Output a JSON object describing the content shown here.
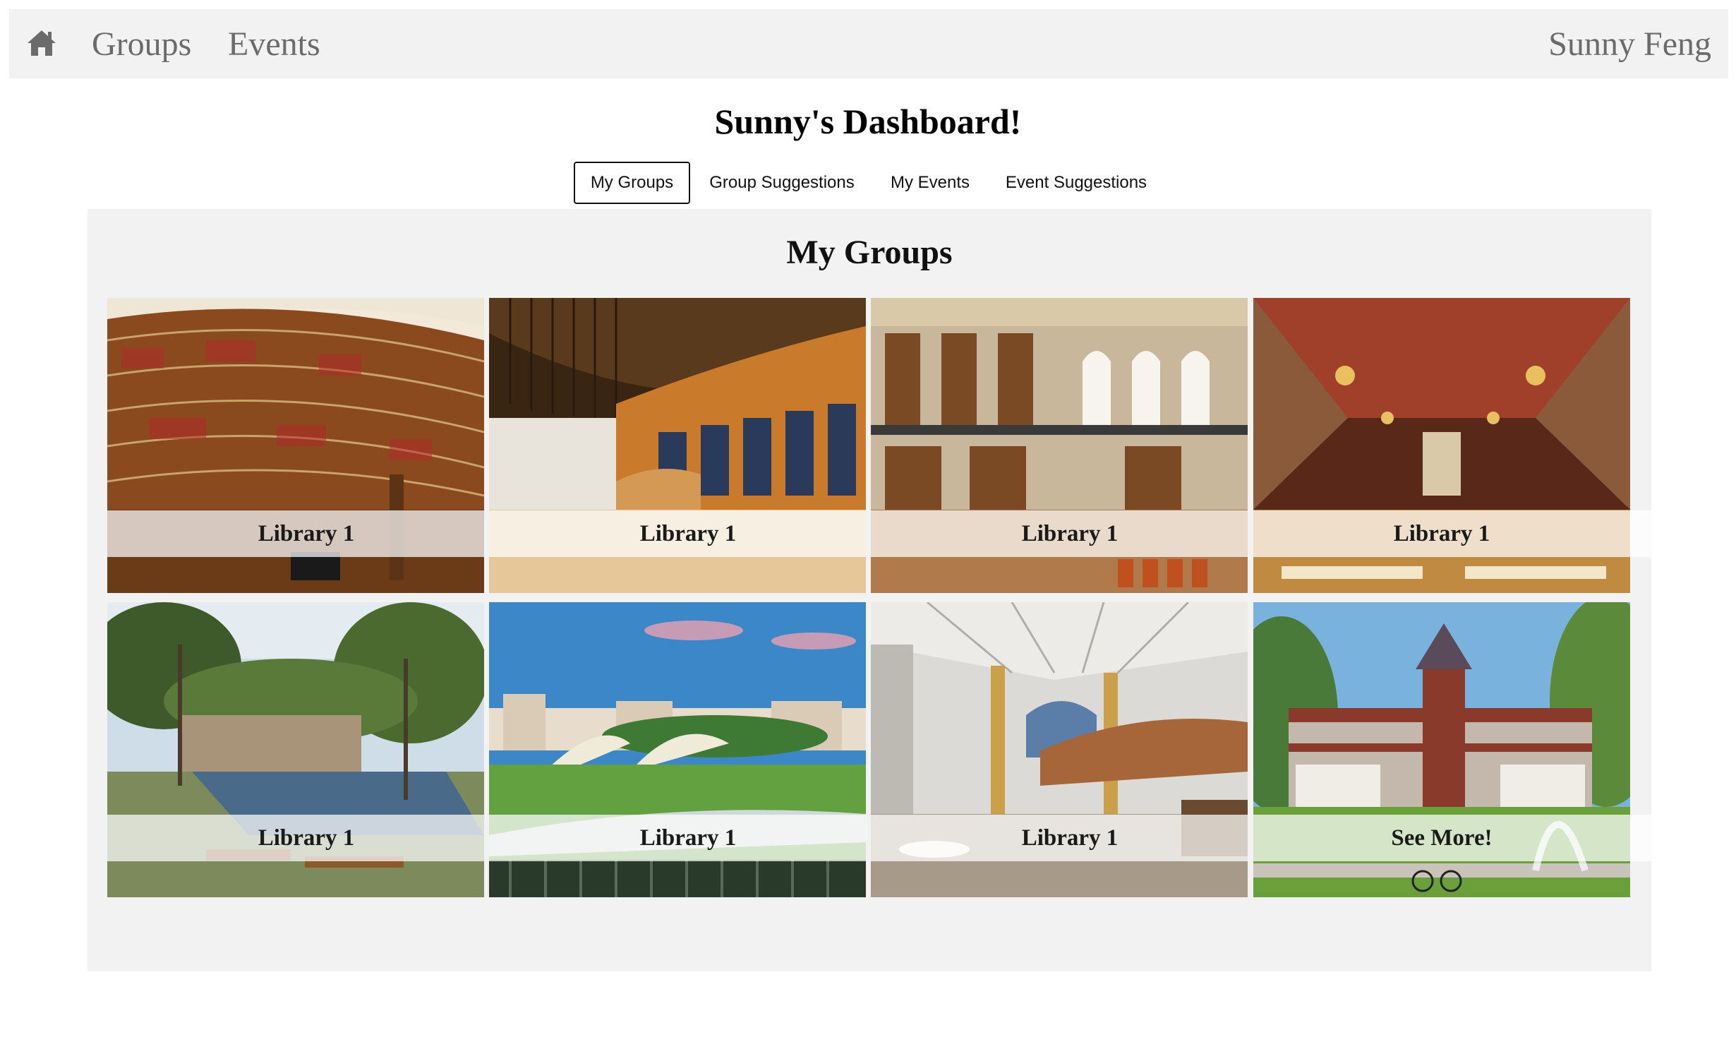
{
  "nav": {
    "home_icon": "home-icon",
    "groups_label": "Groups",
    "events_label": "Events",
    "user_name": "Sunny Feng"
  },
  "page_title": "Sunny's Dashboard!",
  "tabs": [
    {
      "label": "My Groups",
      "active": true
    },
    {
      "label": "Group Suggestions",
      "active": false
    },
    {
      "label": "My Events",
      "active": false
    },
    {
      "label": "Event Suggestions",
      "active": false
    }
  ],
  "panel": {
    "title": "My Groups",
    "cards": [
      {
        "label": "Library 1",
        "image": "circular library shelves"
      },
      {
        "label": "Library 1",
        "image": "modern library with wooden slats"
      },
      {
        "label": "Library 1",
        "image": "ornate library with arched windows"
      },
      {
        "label": "Library 1",
        "image": "gothic reading room with chandeliers"
      },
      {
        "label": "Library 1",
        "image": "outdoor park plaza with trees"
      },
      {
        "label": "Library 1",
        "image": "playground with shade sails"
      },
      {
        "label": "Library 1",
        "image": "atrium with welcome desk"
      },
      {
        "label": "See More!",
        "image": "brick building with fountain"
      }
    ]
  },
  "colors": {
    "nav_bg": "#f2f2f2",
    "nav_text": "#6b6b6b",
    "panel_bg": "#f2f2f2"
  }
}
